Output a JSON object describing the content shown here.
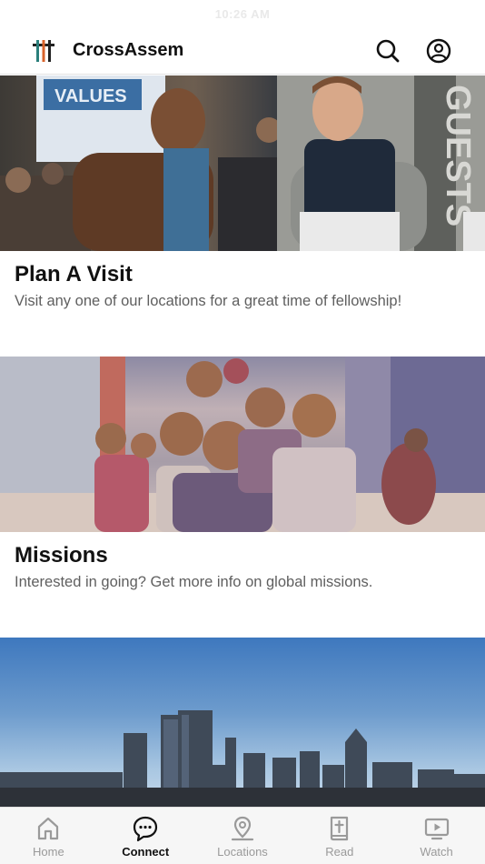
{
  "status_bar": {
    "time": "10:26 AM"
  },
  "header": {
    "title": "CrossAssem",
    "icons": [
      "search-icon",
      "account-icon"
    ]
  },
  "cards": [
    {
      "title": "Plan A Visit",
      "description": "Visit any one of our locations for a great time of fellowship!",
      "image_banner_text": [
        "VALUES",
        "GUESTS"
      ]
    },
    {
      "title": "Missions",
      "description": "Interested in going? Get more info on global missions."
    }
  ],
  "tabs": [
    {
      "label": "Home",
      "icon": "home-icon",
      "active": false
    },
    {
      "label": "Connect",
      "icon": "chat-icon",
      "active": true
    },
    {
      "label": "Locations",
      "icon": "map-pin-icon",
      "active": false
    },
    {
      "label": "Read",
      "icon": "bible-icon",
      "active": false
    },
    {
      "label": "Watch",
      "icon": "tv-play-icon",
      "active": false
    }
  ],
  "colors": {
    "logo_teal": "#2a7f7b",
    "logo_orange": "#d9632b",
    "logo_dark": "#222222",
    "active_tab": "#111111",
    "inactive_tab": "#9a9a9a"
  }
}
